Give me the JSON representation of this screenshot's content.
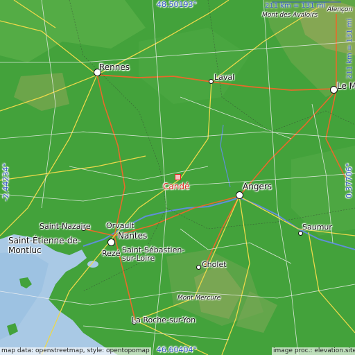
{
  "map": {
    "center_label": "Candé",
    "coords": {
      "north": "48.50193°",
      "south": "46.60404°",
      "west": "-2.44234°",
      "east": "0.37706°"
    },
    "scale": {
      "top": "211 km = 131 mi",
      "right": "211 km = 131 mi"
    },
    "credits": {
      "left": "map data: openstreetmap, style: opentopomap",
      "right": "image proc.: elevation.site"
    },
    "places": {
      "rennes": "Rennes",
      "laval": "Laval",
      "le_mans": "Le M",
      "angers": "Angers",
      "saumur": "Saumur",
      "cholet": "Cholet",
      "nantes": "Nantes",
      "orvault": "Orvault",
      "reze": "Rezé",
      "saint_sebastien": "Saint-Sébastien-\nsur-Loire",
      "saint_nazaire": "Saint-Nazaire",
      "saint_etienne": "Saint-Étienne-de-\nMontluc",
      "la_roche": "La Roche-sur-Yon",
      "mont_mercure": "Mont Mercure",
      "mont_avaloirs": "Mont des Avaloirs",
      "alencon": "Alençon"
    }
  }
}
